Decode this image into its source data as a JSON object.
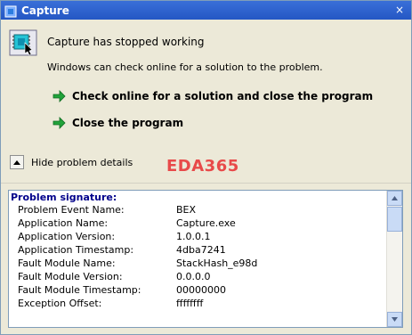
{
  "window": {
    "title": "Capture",
    "close_glyph": "×"
  },
  "dialog": {
    "headline": "Capture has stopped working",
    "subtext": "Windows can check online for a solution to the problem.",
    "options": [
      {
        "label": "Check online for a solution and close the program",
        "icon": "green-arrow-icon"
      },
      {
        "label": "Close the program",
        "icon": "green-arrow-icon"
      }
    ],
    "details_toggle_label": "Hide problem details"
  },
  "watermark": "EDA365",
  "problem": {
    "title": "Problem signature:",
    "rows": [
      {
        "k": "Problem Event Name:",
        "v": "BEX"
      },
      {
        "k": "Application Name:",
        "v": "Capture.exe"
      },
      {
        "k": "Application Version:",
        "v": "1.0.0.1"
      },
      {
        "k": "Application Timestamp:",
        "v": "4dba7241"
      },
      {
        "k": "Fault Module Name:",
        "v": "StackHash_e98d"
      },
      {
        "k": "Fault Module Version:",
        "v": "0.0.0.0"
      },
      {
        "k": "Fault Module Timestamp:",
        "v": "00000000"
      },
      {
        "k": "Exception Offset:",
        "v": "ffffffff"
      }
    ]
  },
  "colors": {
    "accent": "#2457c4",
    "watermark": "#e84a4a",
    "signature_title": "#00008b"
  }
}
